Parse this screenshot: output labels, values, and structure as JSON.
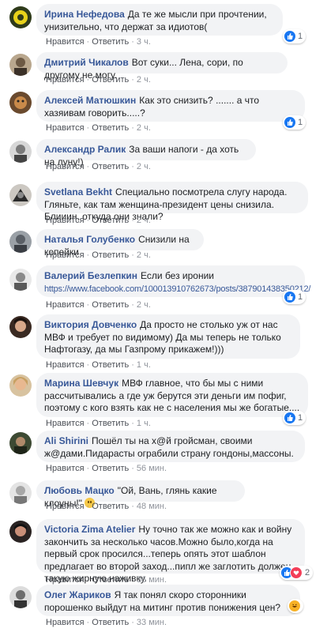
{
  "ui": {
    "like_label": "Нравится",
    "reply_label": "Ответить"
  },
  "comments": [
    {
      "author": "Ирина Нефедова",
      "text": "Да те же мысли при прочтении, унизительно, что держат за идиотов(",
      "time": "3 ч.",
      "reaction_count": "1",
      "reaction": "like"
    },
    {
      "author": "Дмитрий Чикалов",
      "text": "Вот суки... Лена, сори, по другому не могу.",
      "time": "2 ч."
    },
    {
      "author": "Алексей Матюшкин",
      "text": "Как это снизить? ....... а что хазяивам говорить.....?",
      "time": "2 ч.",
      "reaction_count": "1",
      "reaction": "like"
    },
    {
      "author": "Александр Ралик",
      "text": "За ваши напоги - да хоть на луну!)",
      "time": "2 ч."
    },
    {
      "author": "Svetlana Bekht",
      "text": "Специально посмотрела слугу народа. Гляньте, как там женщина-президент цены снизила. Блииин, откуда они знали?",
      "time": "2 ч."
    },
    {
      "author": "Наталья Голубенко",
      "text": "Снизили на копейки",
      "time": "2 ч."
    },
    {
      "author": "Валерий Безлепкин",
      "text": "Если без иронии",
      "link": "https://www.facebook.com/100013910762673/posts/387901438350212/",
      "time": "2 ч.",
      "reaction_count": "1",
      "reaction": "like"
    },
    {
      "author": "Виктория Довченко",
      "text": "Да просто не столько уж от нас МВФ и требует по видимому) Да мы теперь не только Нафтогазу, да мы Газпрому прикажем!)))",
      "time": "1 ч."
    },
    {
      "author": "Марина Шевчук",
      "text": "МВФ главное, что бы мы с ними рассчитывались а где уж берутся эти деньги им пофиг, поэтому с кого взять как не с населения мы же богатые....",
      "time": "1 ч.",
      "reaction_count": "1",
      "reaction": "like"
    },
    {
      "author": "Ali Shirini",
      "text": "Пошёл ты на х@й гройсман, своими ж@дами.Пидарасты ограбили страну гондоны,массоны.",
      "time": "56 мин."
    },
    {
      "author": "Любовь Мацко",
      "text": "\"Ой, Вань, глянь какие клоуны!\"",
      "time": "48 мин."
    },
    {
      "author": "Victoria Zima Atelier",
      "text": "Ну точно так же можно как и войну закончить за несколько часов.Можно было,когда на первый срок просился...теперь опять этот шаблон предлагает во второй заход...пипл же заглотить должен такую жирную наживку.",
      "time": "36 мин.",
      "reaction_count": "2",
      "reaction": "like-love"
    },
    {
      "author": "Олег Жариков",
      "text": "Я так понял скоро сторонники порошенко выйдут на митинг против понижения цен?",
      "time": "33 мин.",
      "reaction": "haha"
    }
  ],
  "colors": {
    "author": "#385898",
    "bubble": "#f2f3f5",
    "like": "#1877f2",
    "love": "#f33e58",
    "haha": "#f7b125"
  }
}
